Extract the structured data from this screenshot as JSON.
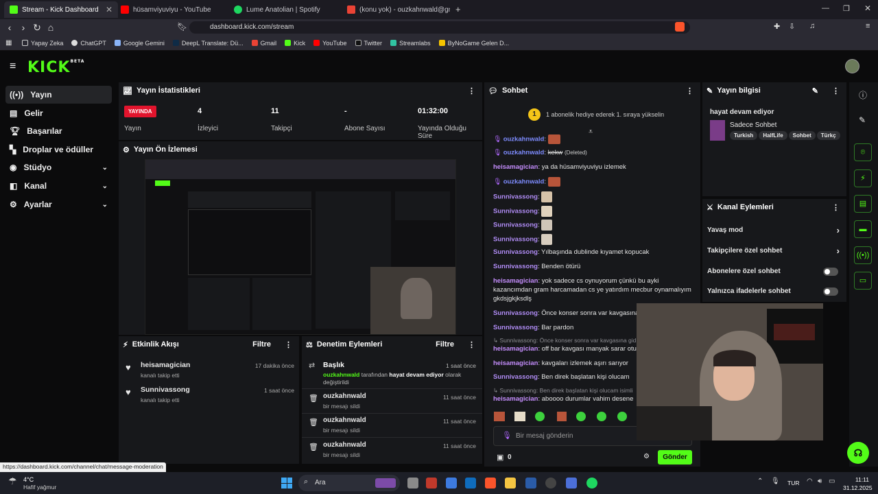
{
  "browser": {
    "tabs": [
      {
        "label": "Stream - Kick Dashboard",
        "color": "#53fc18"
      },
      {
        "label": "hüsamviyuviyu - YouTube",
        "color": "#ff0000"
      },
      {
        "label": "Lume Anatolian | Spotify",
        "color": "#1ed760"
      },
      {
        "label": "(konu yok) - ouzkahnwald@gmail.co",
        "color": "#ea4335"
      }
    ],
    "url": "dashboard.kick.com/stream",
    "bookmarks": [
      "Yapay Zeka",
      "ChatGPT",
      "Google Gemini",
      "DeepL Translate: Dü...",
      "Gmail",
      "Kick",
      "YouTube",
      "Twitter",
      "Streamlabs",
      "ByNoGame Gelen D..."
    ]
  },
  "logo": "KICK",
  "logo_beta": "BETA",
  "sidebar": [
    {
      "label": "Yayın",
      "icon": "broadcast-icon"
    },
    {
      "label": "Gelir",
      "icon": "revenue-icon"
    },
    {
      "label": "Başarılar",
      "icon": "trophy-icon"
    },
    {
      "label": "Droplar ve ödüller",
      "icon": "gift-icon"
    },
    {
      "label": "Stüdyo",
      "icon": "studio-icon"
    },
    {
      "label": "Kanal",
      "icon": "channel-icon"
    },
    {
      "label": "Ayarlar",
      "icon": "gear-icon"
    }
  ],
  "stats": {
    "title": "Yayın İstatistikleri",
    "items": [
      {
        "value": "YAYINDA",
        "label": "Yayın"
      },
      {
        "value": "4",
        "label": "İzleyici"
      },
      {
        "value": "11",
        "label": "Takipçi"
      },
      {
        "value": "-",
        "label": "Abone Sayısı"
      },
      {
        "value": "01:32:00",
        "label": "Yayında Olduğu Süre"
      }
    ]
  },
  "preview": {
    "title": "Yayın Ön İzlemesi"
  },
  "activity": {
    "title": "Etkinlik Akışı",
    "filter": "Filtre",
    "items": [
      {
        "user": "heisamagician",
        "action": "kanalı takip etti",
        "time": "17 dakika önce"
      },
      {
        "user": "Sunnivassong",
        "action": "kanalı takip etti",
        "time": "1 saat önce"
      }
    ]
  },
  "moderation": {
    "title": "Denetim Eylemleri",
    "filter": "Filtre",
    "first": {
      "title": "Başlık",
      "user": "ouzkahnwald",
      "mid": "tarafından",
      "bold": "hayat devam ediyor",
      "tail": "olarak değiştirildi",
      "time": "1 saat önce"
    },
    "items": [
      {
        "user": "ouzkahnwald",
        "action": "bir mesajı sildi",
        "time": "11 saat önce"
      },
      {
        "user": "ouzkahnwald",
        "action": "bir mesajı sildi",
        "time": "11 saat önce"
      },
      {
        "user": "ouzkahnwald",
        "action": "bir mesajı sildi",
        "time": "11 saat önce"
      }
    ]
  },
  "chat": {
    "title": "Sohbet",
    "gift_badge": "1",
    "gift_text": "1 abonelik hediye ederek 1. sıraya yükselin",
    "messages": [
      {
        "user": "ouzkahnwald",
        "text": ""
      },
      {
        "user": "ouzkahnwald",
        "text": "kekw",
        "deleted": "(Deleted)"
      },
      {
        "user": "heisamagician",
        "text": "ya da hüsamviyuviyu izlemek"
      },
      {
        "user": "ouzkahnwald",
        "text": ""
      },
      {
        "user": "Sunnivassong",
        "text": ""
      },
      {
        "user": "Sunnivassong",
        "text": ""
      },
      {
        "user": "Sunnivassong",
        "text": ""
      },
      {
        "user": "Sunnivassong",
        "text": ""
      },
      {
        "user": "Sunnivassong",
        "text": "Yılbaşında dublinde kıyamet kopucak"
      },
      {
        "user": "Sunnivassong",
        "text": "Benden ötürü"
      },
      {
        "user": "heisamagician",
        "text": "yok sadece cs oynuyorum çünkü bu ayki"
      },
      {
        "user": "",
        "text": "kazancımdan gram harcamadan cs ye yatırdım mecbur oynamalıyım"
      },
      {
        "user": "",
        "text": "gkdsjgkjksdlş"
      },
      {
        "user": "Sunnivassong",
        "text": "Önce konser sonra var kavgasına gi"
      },
      {
        "user": "Sunnivassong",
        "text": "Bar pardon"
      },
      {
        "user": "",
        "text": "↳ Sunnivassong: Önce konser sonra var kavgasına gid"
      },
      {
        "user": "heisamagician",
        "text": "off bar kavgası manyak sarar oturu"
      },
      {
        "user": "heisamagician",
        "text": "kavgaları izlemek aşırı sarıyor"
      },
      {
        "user": "Sunnivassong",
        "text": "Ben direk başlatan kişi olucam"
      },
      {
        "user": "",
        "text": "↳ Sunnivassong: Ben direk başlatan kişi olucam isimli"
      },
      {
        "user": "heisamagician",
        "text": "aboooo durumlar vahim desene"
      }
    ],
    "input_placeholder": "Bir mesaj gönderin",
    "points": "0",
    "send": "Gönder"
  },
  "info": {
    "title": "Yayın bilgisi",
    "stream_title": "hayat devam ediyor",
    "category": "Sadece Sohbet",
    "tags": [
      "Turkish",
      "HalfLife",
      "Sohbet",
      "Türkç"
    ]
  },
  "channel_actions": {
    "title": "Kanal Eylemleri",
    "items": [
      {
        "label": "Yavaş mod",
        "kind": "chevron"
      },
      {
        "label": "Takipçilere özel sohbet",
        "kind": "chevron"
      },
      {
        "label": "Abonelere özel sohbet",
        "kind": "toggle"
      },
      {
        "label": "Yalnızca ifadelerle sohbet",
        "kind": "toggle"
      }
    ]
  },
  "status_url": "https://dashboard.kick.com/channel/chat/message-moderation",
  "taskbar": {
    "weather_temp": "4°C",
    "weather_desc": "Hafif yağmur",
    "search": "Ara",
    "lang": "TUR",
    "time": "11:11",
    "date": "31.12.2025"
  }
}
